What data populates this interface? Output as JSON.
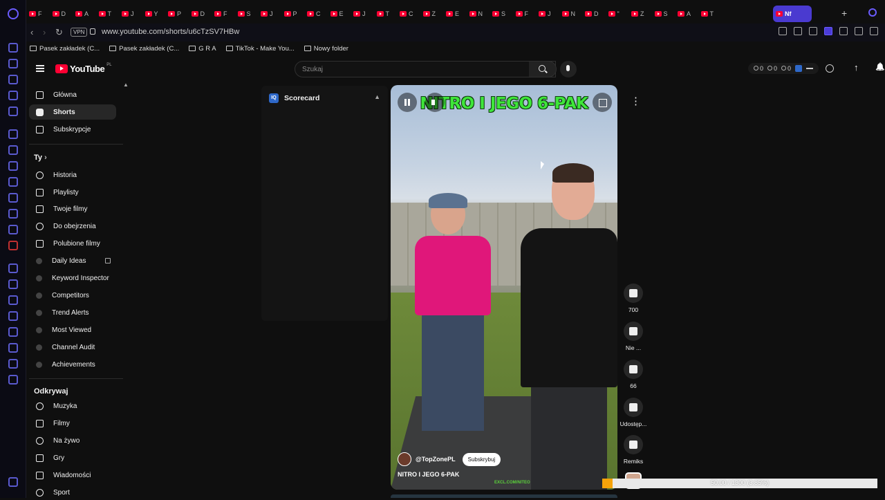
{
  "browser": {
    "tabs": [
      "F",
      "D",
      "A",
      "T",
      "J",
      "Y",
      "P",
      "D",
      "F",
      "S",
      "J",
      "P",
      "C",
      "E",
      "J",
      "T",
      "C",
      "Z",
      "E",
      "N",
      "S",
      "F",
      "J",
      "N",
      "D",
      "\"",
      "Z",
      "S",
      "A",
      "T"
    ],
    "active_tab_label": "Nf",
    "url": "www.youtube.com/shorts/u6cTzSV7HBw",
    "vpn_label": "VPN",
    "bookmarks": [
      "Pasek zakładek (C...",
      "Pasek zakładek (C...",
      "G R A",
      "TikTok - Make You...",
      "Nowy folder"
    ]
  },
  "youtube": {
    "logo_text": "YouTube",
    "country_code": "PL",
    "search_placeholder": "Szukaj",
    "header_stats": [
      "0",
      "0",
      "0"
    ]
  },
  "sidebar": {
    "main": [
      {
        "label": "Główna",
        "icon": "home-icon"
      },
      {
        "label": "Shorts",
        "icon": "shorts-icon"
      },
      {
        "label": "Subskrypcje",
        "icon": "subscriptions-icon"
      }
    ],
    "you_title": "Ty",
    "you_items": [
      {
        "label": "Historia",
        "icon": "history-icon"
      },
      {
        "label": "Playlisty",
        "icon": "playlists-icon"
      },
      {
        "label": "Twoje filmy",
        "icon": "your-videos-icon"
      },
      {
        "label": "Do obejrzenia",
        "icon": "watch-later-icon"
      },
      {
        "label": "Polubione filmy",
        "icon": "liked-videos-icon"
      }
    ],
    "extension_items": [
      "Daily Ideas",
      "Keyword Inspector",
      "Competitors",
      "Trend Alerts",
      "Most Viewed",
      "Channel Audit",
      "Achievements"
    ],
    "explore_title": "Odkrywaj",
    "explore_items": [
      {
        "label": "Muzyka",
        "icon": "music-icon"
      },
      {
        "label": "Filmy",
        "icon": "movies-icon"
      },
      {
        "label": "Na żywo",
        "icon": "live-icon"
      },
      {
        "label": "Gry",
        "icon": "gaming-icon"
      },
      {
        "label": "Wiadomości",
        "icon": "news-icon"
      },
      {
        "label": "Sport",
        "icon": "sport-icon"
      }
    ]
  },
  "scorecard": {
    "badge": "IQ",
    "title": "Scorecard"
  },
  "short": {
    "overlay_title": "NITRO I JEGO 6-PAK",
    "channel": "@TopZonePL",
    "subscribe_label": "Subskrybuj",
    "caption": "NITRO I JEGO 6-PAK",
    "watermark": "EXCL.COM/NITEO",
    "actions": [
      {
        "label": "700",
        "icon": "like-icon"
      },
      {
        "label": "Nie ...",
        "icon": "dislike-icon"
      },
      {
        "label": "66",
        "icon": "comments-icon"
      },
      {
        "label": "Udostęp...",
        "icon": "share-icon"
      },
      {
        "label": "Remiks",
        "icon": "remix-icon"
      }
    ]
  },
  "progress": {
    "text": "50.00 / 1300 (3.85%)",
    "fraction": 0.0385,
    "color": "#f5a30a"
  },
  "colors": {
    "accent": "#4a3ad0",
    "youtube_red": "#ff0033",
    "title_green": "#3fe63a"
  }
}
